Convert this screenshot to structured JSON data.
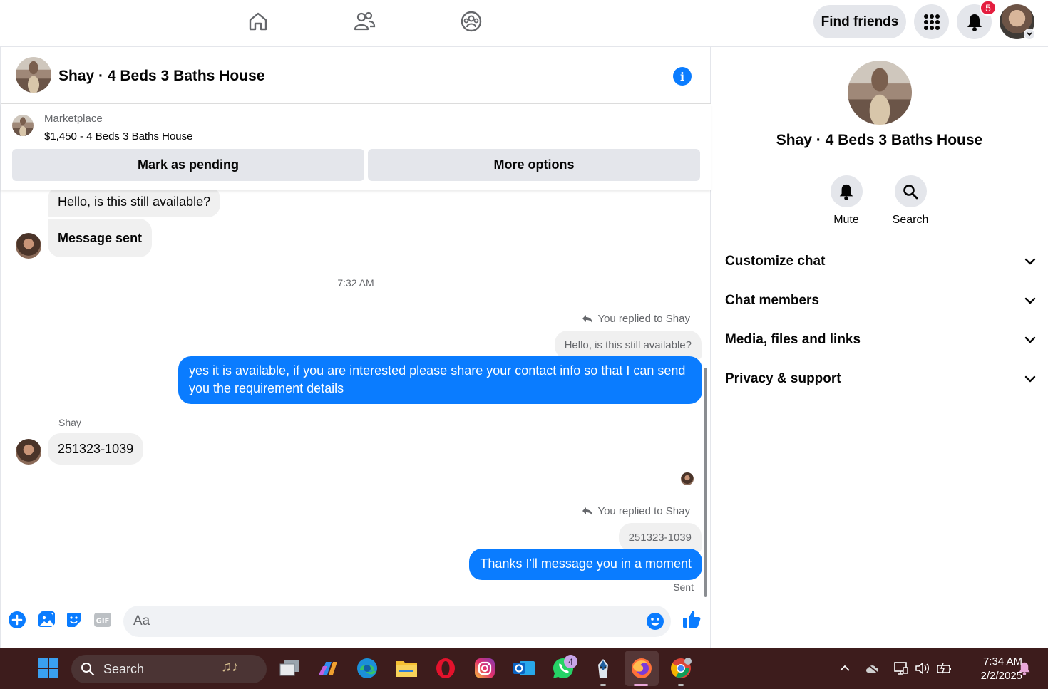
{
  "topnav": {
    "icons": [
      "home-icon",
      "friends-icon",
      "groups-icon"
    ],
    "find_friends_label": "Find friends",
    "notification_count": "5"
  },
  "chat": {
    "title": "Shay · 4 Beds 3 Baths House",
    "marketplace": {
      "label": "Marketplace",
      "listing": "$1,450 - 4 Beds 3 Baths House",
      "mark_pending_label": "Mark as pending",
      "more_options_label": "More options"
    },
    "messages": {
      "incoming_1": "Hello, is this still available?",
      "incoming_2": "Message sent",
      "timestamp": "7:32 AM",
      "replied_note_1": "You replied to Shay",
      "quote_1": "Hello, is this still available?",
      "outgoing_1": "yes it is available, if you are interested please share your contact info so that I can send you the requirement details",
      "sender_name": "Shay",
      "incoming_3": "251323-1039",
      "replied_note_2": "You replied to Shay",
      "quote_2": "251323-1039",
      "outgoing_2": "Thanks I'll message you in a moment",
      "status": "Sent"
    },
    "composer": {
      "placeholder": "Aa",
      "icons": [
        "plus-icon",
        "image-icon",
        "sticker-icon",
        "gif-icon",
        "emoji-icon",
        "thumbs-up-icon"
      ],
      "gif_label": "GIF"
    }
  },
  "side": {
    "title": "Shay · 4 Beds 3 Baths House",
    "actions": [
      {
        "label": "Mute",
        "icon": "bell-icon"
      },
      {
        "label": "Search",
        "icon": "search-icon"
      }
    ],
    "sections": [
      "Customize chat",
      "Chat members",
      "Media, files and links",
      "Privacy & support"
    ]
  },
  "taskbar": {
    "search_label": "Search",
    "whatsapp_badge": "4",
    "time": "7:34 AM",
    "date": "2/2/2025"
  },
  "colors": {
    "accent": "#0a7cff",
    "taskbar": "#3d1c1c",
    "badge": "#e41e3f"
  }
}
